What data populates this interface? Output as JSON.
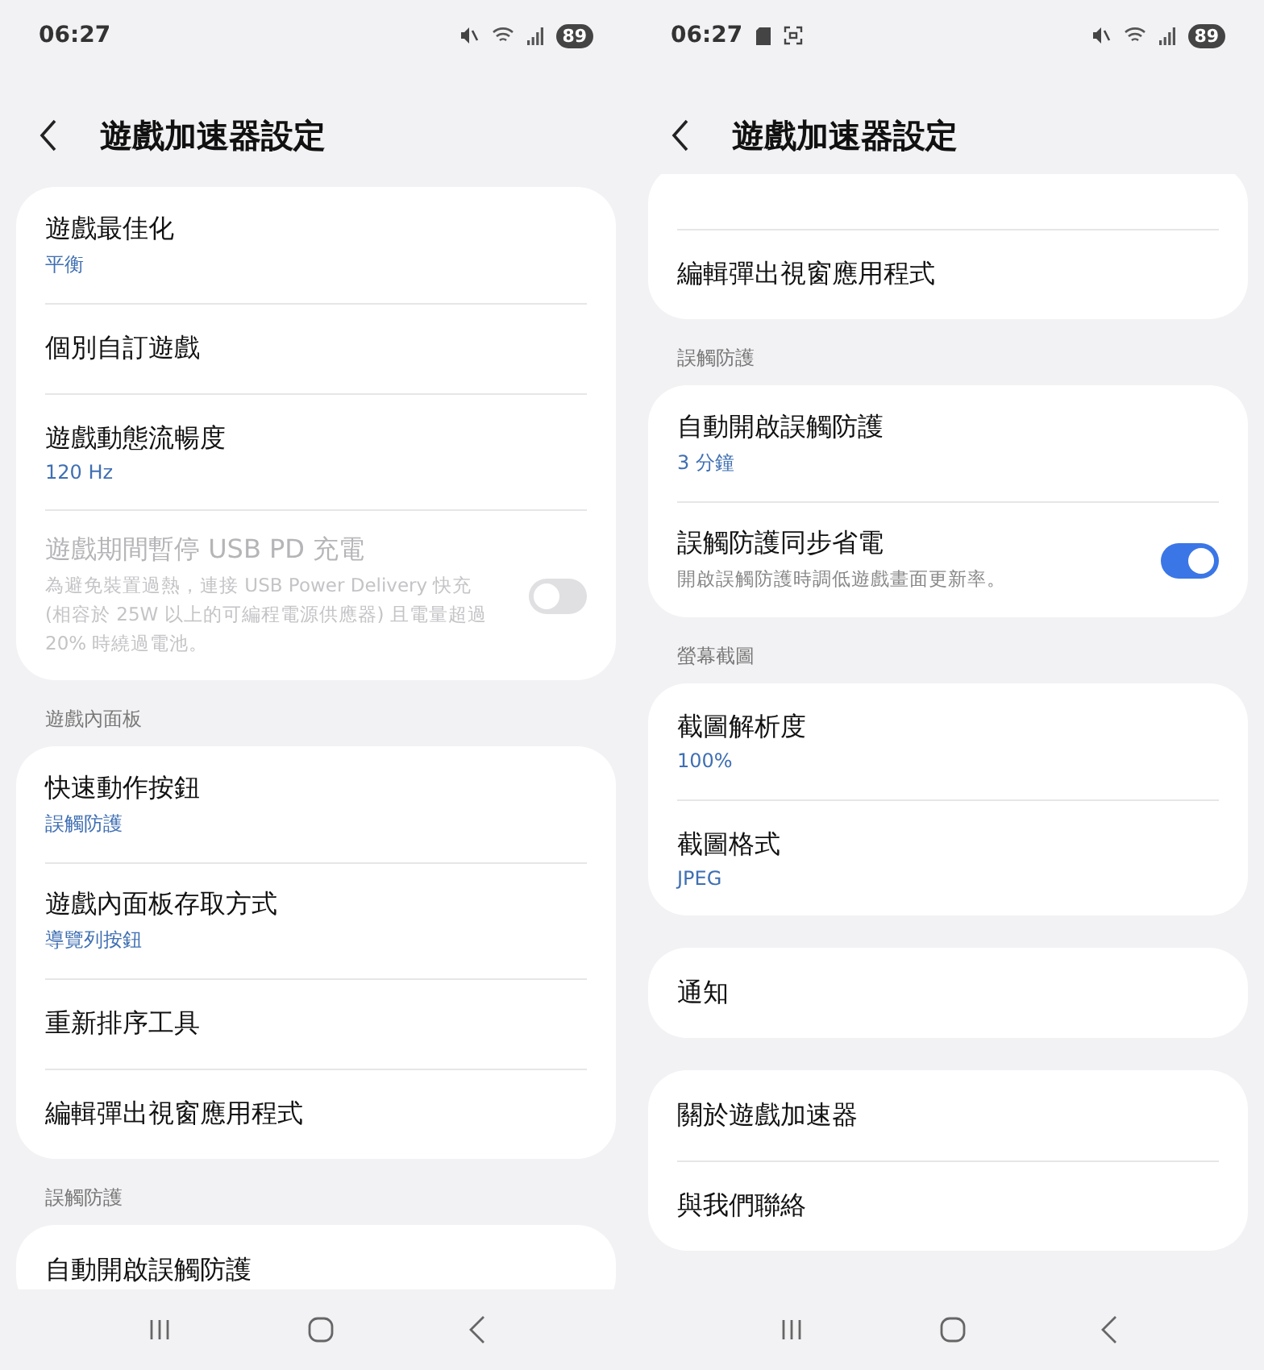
{
  "screens": [
    {
      "status_bar": {
        "time": "06:27",
        "battery": "89"
      },
      "header": {
        "title": "遊戲加速器設定"
      },
      "sections": [
        {
          "items": [
            {
              "kind": "link",
              "title": "遊戲最佳化",
              "subtitle": "平衡"
            },
            {
              "kind": "link",
              "title": "個別自訂遊戲"
            },
            {
              "kind": "link",
              "title": "遊戲動態流暢度",
              "subtitle": "120 Hz"
            },
            {
              "kind": "toggle",
              "title": "遊戲期間暫停 USB PD 充電",
              "description": "為避免裝置過熱，連接 USB Power Delivery 快充 (相容於 25W 以上的可編程電源供應器) 且電量超過 20% 時繞過電池。",
              "disabled": true,
              "on": false
            }
          ]
        },
        {
          "label": "遊戲內面板",
          "items": [
            {
              "kind": "link",
              "title": "快速動作按鈕",
              "subtitle": "誤觸防護"
            },
            {
              "kind": "link",
              "title": "遊戲內面板存取方式",
              "subtitle": "導覽列按鈕"
            },
            {
              "kind": "link",
              "title": "重新排序工具"
            },
            {
              "kind": "link",
              "title": "編輯彈出視窗應用程式"
            }
          ]
        },
        {
          "label": "誤觸防護",
          "items": [
            {
              "kind": "link",
              "title": "自動開啟誤觸防護"
            }
          ]
        }
      ]
    },
    {
      "status_bar": {
        "time": "06:27",
        "notification_icons": [
          {
            "kind": "sd-card"
          },
          {
            "kind": "screenshot"
          }
        ],
        "battery": "89"
      },
      "header": {
        "title": "遊戲加速器設定"
      },
      "sections": [
        {
          "items": [
            {
              "kind": "link",
              "title": "編輯彈出視窗應用程式"
            }
          ]
        },
        {
          "label": "誤觸防護",
          "items": [
            {
              "kind": "link",
              "title": "自動開啟誤觸防護",
              "subtitle": "3 分鐘"
            },
            {
              "kind": "toggle",
              "title": "誤觸防護同步省電",
              "description": "開啟誤觸防護時調低遊戲畫面更新率。",
              "disabled": false,
              "on": true
            }
          ]
        },
        {
          "label": "螢幕截圖",
          "items": [
            {
              "kind": "link",
              "title": "截圖解析度",
              "subtitle": "100%"
            },
            {
              "kind": "link",
              "title": "截圖格式",
              "subtitle": "JPEG"
            }
          ]
        },
        {
          "items": [
            {
              "kind": "link",
              "title": "通知"
            }
          ]
        },
        {
          "items": [
            {
              "kind": "link",
              "title": "關於遊戲加速器"
            },
            {
              "kind": "link",
              "title": "與我們聯絡"
            }
          ]
        }
      ]
    }
  ]
}
